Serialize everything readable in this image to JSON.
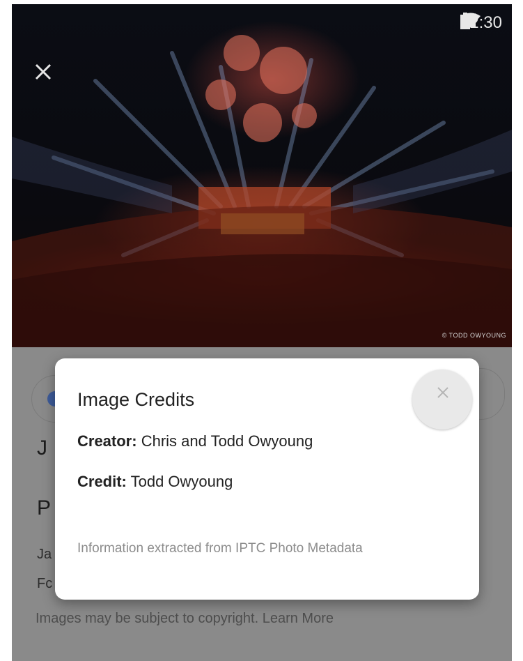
{
  "status_bar": {
    "time": "12:30",
    "icons": [
      "wifi-icon",
      "cellular-signal-icon",
      "battery-icon"
    ]
  },
  "photo": {
    "watermark": "© TODD OWYOUNG",
    "close_icon": "close-icon"
  },
  "background": {
    "title_line_1": "J",
    "title_line_2": "P",
    "desc_line_1": "Ja",
    "desc_line_2": "Fc",
    "copyright_note": "Images may be subject to copyright. Learn More"
  },
  "dialog": {
    "title": "Image Credits",
    "creator_label": "Creator:",
    "creator_value": "Chris and Todd Owyoung",
    "credit_label": "Credit:",
    "credit_value": "Todd Owyoung",
    "footnote": "Information extracted from IPTC Photo Metadata",
    "close_icon": "close-icon"
  },
  "colors": {
    "scrim": "#8a8a8a",
    "dialog_bg": "#ffffff",
    "close_button_bg": "#e9e9e9"
  }
}
